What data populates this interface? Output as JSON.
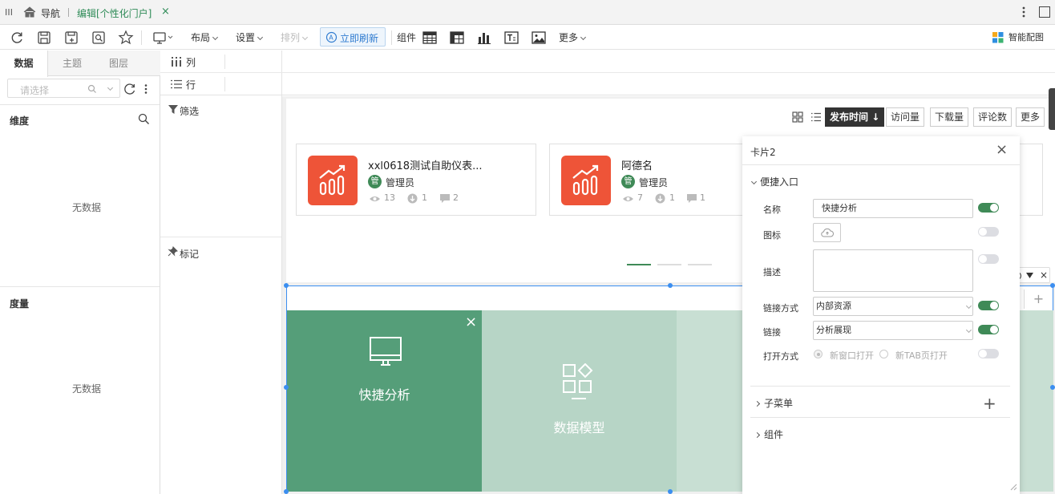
{
  "tabbar": {
    "nav_label": "导航",
    "edit_tab_label": "编辑[个性化门户]"
  },
  "toolbar": {
    "layout": "布局",
    "settings": "设置",
    "sort": "排列",
    "refresh": "立即刷新",
    "component": "组件",
    "more": "更多",
    "smart": "智能配图"
  },
  "left_panel": {
    "tabs": [
      "数据",
      "主题",
      "图层"
    ],
    "search_placeholder": "请选择",
    "dimension_title": "维度",
    "dimension_empty": "无数据",
    "measure_title": "度量",
    "measure_empty": "无数据"
  },
  "mid_panel": {
    "columns": "列",
    "rows": "行",
    "filter": "筛选",
    "mark": "标记"
  },
  "sort_bar": {
    "buttons": [
      "发布时间",
      "访问量",
      "下载量",
      "评论数",
      "更多"
    ],
    "active_index": 0
  },
  "cards": [
    {
      "title": "xxl0618测试自助仪表...",
      "badge": "管",
      "owner": "管理员",
      "views": "13",
      "downloads": "1",
      "comments": "2"
    },
    {
      "title": "阿德名",
      "badge": "管",
      "owner": "管理员",
      "views": "7",
      "downloads": "1",
      "comments": "1"
    }
  ],
  "tiles": [
    {
      "label": "快捷分析",
      "icon": "monitor-icon"
    },
    {
      "label": "数据模型",
      "icon": "data-model-icon"
    }
  ],
  "colors": {
    "accent": "#3f8a57",
    "tile1": "#559e79",
    "tile2": "#b7d5c6",
    "tile3": "#c8dfd3",
    "card_icon": "#ee5438",
    "sort_active": "#333333"
  },
  "prop_panel": {
    "title": "卡片2",
    "section_quick": "便捷入口",
    "name_label": "名称",
    "name_value": "快捷分析",
    "icon_label": "图标",
    "desc_label": "描述",
    "link_type_label": "链接方式",
    "link_type_value": "内部资源",
    "link_label": "链接",
    "link_value": "分析展现",
    "open_label": "打开方式",
    "open_new_window": "新窗口打开",
    "open_new_tab": "新TAB页打开",
    "submenu": "子菜单",
    "components": "组件"
  }
}
